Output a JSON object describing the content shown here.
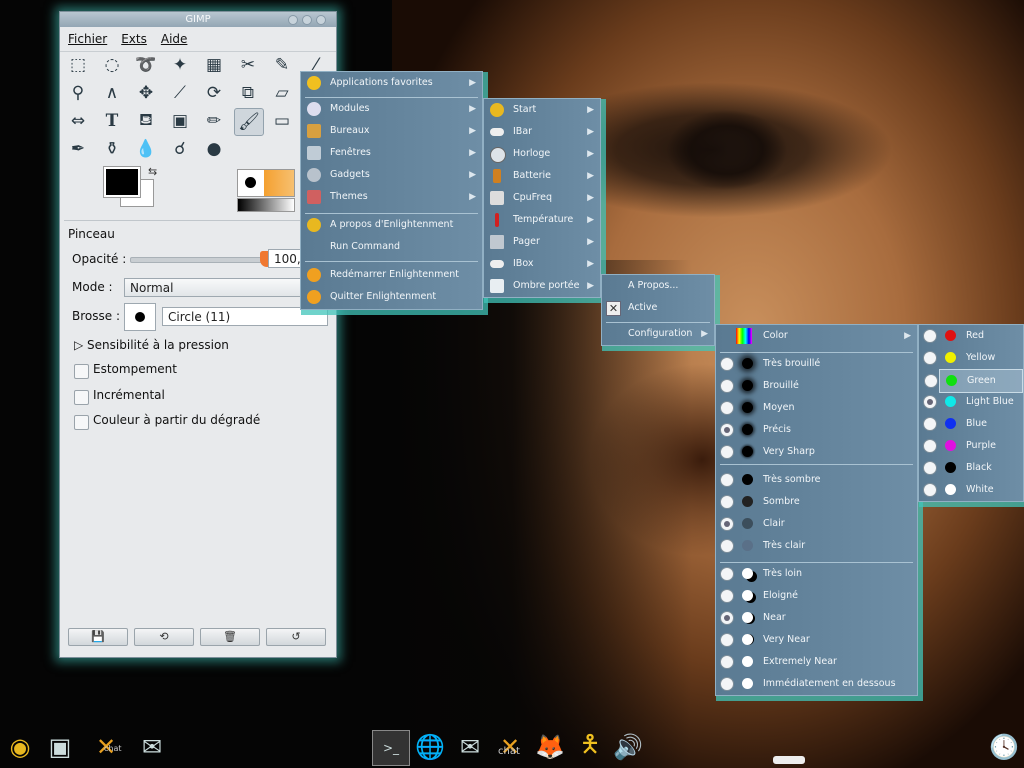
{
  "gimp": {
    "title": "GIMP",
    "menu": [
      "Fichier",
      "Exts",
      "Aide"
    ],
    "tools": [
      "rect-select",
      "ellipse-select",
      "lasso",
      "fuzzy-select",
      "color-select",
      "scissors",
      "paths",
      "color-picker",
      "zoom",
      "measure",
      "move",
      "crop",
      "rotate",
      "scale",
      "shear",
      "perspective",
      "flip",
      "text",
      "bucket-fill",
      "blend",
      "pencil",
      "paintbrush",
      "eraser",
      "airbrush",
      "ink",
      "clone",
      "blur",
      "smudge",
      "dodge-burn"
    ],
    "panel": {
      "title": "Pinceau",
      "opacity_label": "Opacité :",
      "opacity_value": "100,0",
      "opacity": 1.0,
      "mode_label": "Mode :",
      "mode_value": "Normal",
      "brush_label": "Brosse :",
      "brush_value": "Circle (11)",
      "pressure": "Sensibilité à la pression",
      "opt1": "Estompement",
      "opt2": "Incrémental",
      "opt3": "Couleur à partir du dégradé"
    }
  },
  "menu_main": {
    "items": [
      {
        "label": "Applications favorites",
        "icon": "star-icon",
        "sub": true
      },
      {
        "label": "Modules",
        "icon": "module-icon",
        "sub": true
      },
      {
        "label": "Bureaux",
        "icon": "desktop-icon",
        "sub": true
      },
      {
        "label": "Fenêtres",
        "icon": "window-icon",
        "sub": true
      },
      {
        "label": "Gadgets",
        "icon": "gadget-icon",
        "sub": true
      },
      {
        "label": "Themes",
        "icon": "theme-icon",
        "sub": true
      },
      {
        "label": "A propos d'Enlightenment",
        "icon": "e-icon",
        "sub": false
      },
      {
        "label": "Run Command",
        "icon": "",
        "sub": false
      },
      {
        "label": "Redémarrer Enlightenment",
        "icon": "restart-icon",
        "sub": false
      },
      {
        "label": "Quitter Enlightenment",
        "icon": "quit-icon",
        "sub": false
      }
    ]
  },
  "menu_modules": {
    "items": [
      {
        "label": "Start",
        "icon": "start-icon"
      },
      {
        "label": "IBar",
        "icon": "ibar-icon"
      },
      {
        "label": "Horloge",
        "icon": "clock-icon"
      },
      {
        "label": "Batterie",
        "icon": "battery-icon"
      },
      {
        "label": "CpuFreq",
        "icon": "cpu-icon"
      },
      {
        "label": "Température",
        "icon": "thermometer-icon"
      },
      {
        "label": "Pager",
        "icon": "pager-icon"
      },
      {
        "label": "IBox",
        "icon": "ibox-icon"
      },
      {
        "label": "Ombre portée",
        "icon": "shadow-icon"
      }
    ]
  },
  "menu_shadow": {
    "about": "A Propos...",
    "active": "Active",
    "config": "Configuration"
  },
  "menu_config": {
    "color": "Color",
    "sharpness": [
      "Très brouillé",
      "Brouillé",
      "Moyen",
      "Précis",
      "Very Sharp"
    ],
    "sharpness_selected": 3,
    "darkness": [
      "Très sombre",
      "Sombre",
      "Clair",
      "Très clair"
    ],
    "darkness_selected": 2,
    "distance": [
      "Très loin",
      "Eloigné",
      "Near",
      "Very Near",
      "Extremely Near",
      "Immédiatement en dessous"
    ],
    "distance_selected": 2
  },
  "menu_colors": {
    "items": [
      {
        "label": "Red",
        "color": "#e01010"
      },
      {
        "label": "Yellow",
        "color": "#f0f000"
      },
      {
        "label": "Green",
        "color": "#10e010"
      },
      {
        "label": "Light Blue",
        "color": "#10e8e8"
      },
      {
        "label": "Blue",
        "color": "#1030f0"
      },
      {
        "label": "Purple",
        "color": "#e010e0"
      },
      {
        "label": "Black",
        "color": "#000000"
      },
      {
        "label": "White",
        "color": "#ffffff"
      }
    ],
    "selected": 3,
    "hover": 2
  },
  "dock_labels": {
    "chat1": "chat",
    "chat2": "chat"
  }
}
